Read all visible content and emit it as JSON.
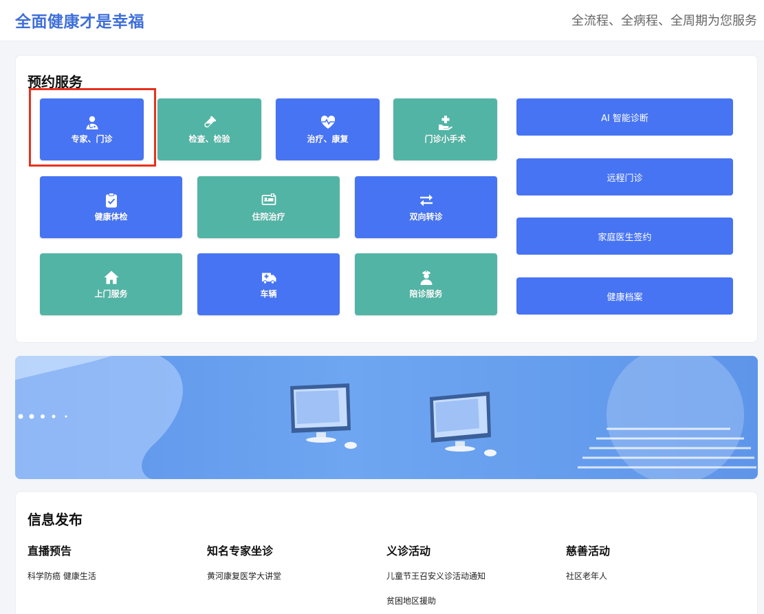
{
  "header": {
    "brand": "全面健康才是幸福",
    "slogan": "全流程、全病程、全周期为您服务"
  },
  "appointment": {
    "title": "预约服务",
    "tiles": [
      {
        "label": "专家、门诊",
        "icon": "doctor-icon",
        "color": "#4774f2"
      },
      {
        "label": "检查、检验",
        "icon": "test-tube-icon",
        "color": "#52b4a5"
      },
      {
        "label": "治疗、康复",
        "icon": "heartbeat-icon",
        "color": "#4774f2"
      },
      {
        "label": "门诊小手术",
        "icon": "medical-hand-icon",
        "color": "#52b4a5"
      },
      {
        "label": "健康体检",
        "icon": "clipboard-check-icon",
        "color": "#4774f2"
      },
      {
        "label": "住院治疗",
        "icon": "hospital-bed-icon",
        "color": "#52b4a5"
      },
      {
        "label": "双向转诊",
        "icon": "exchange-arrows-icon",
        "color": "#4774f2"
      },
      {
        "label": "上门服务",
        "icon": "home-icon",
        "color": "#52b4a5"
      },
      {
        "label": "车辆",
        "icon": "ambulance-icon",
        "color": "#4774f2"
      },
      {
        "label": "陪诊服务",
        "icon": "nurse-icon",
        "color": "#52b4a5"
      }
    ],
    "side_buttons": [
      {
        "label": "AI 智能诊断"
      },
      {
        "label": "远程门诊"
      },
      {
        "label": "家庭医生签约"
      },
      {
        "label": "健康档案"
      }
    ]
  },
  "info": {
    "title": "信息发布",
    "columns": [
      {
        "title": "直播预告",
        "items": [
          "科学防癌 健康生活"
        ]
      },
      {
        "title": "知名专家坐诊",
        "items": [
          "黄河康复医学大讲堂"
        ]
      },
      {
        "title": "义诊活动",
        "items": [
          "儿童节王召安义诊活动通知",
          "贫困地区援助"
        ]
      },
      {
        "title": "慈善活动",
        "items": [
          "社区老年人"
        ]
      }
    ]
  },
  "colors": {
    "brand": "#3f6fd8",
    "tile_blue": "#4774f2",
    "tile_teal": "#52b4a5",
    "highlight": "#e8301c"
  }
}
